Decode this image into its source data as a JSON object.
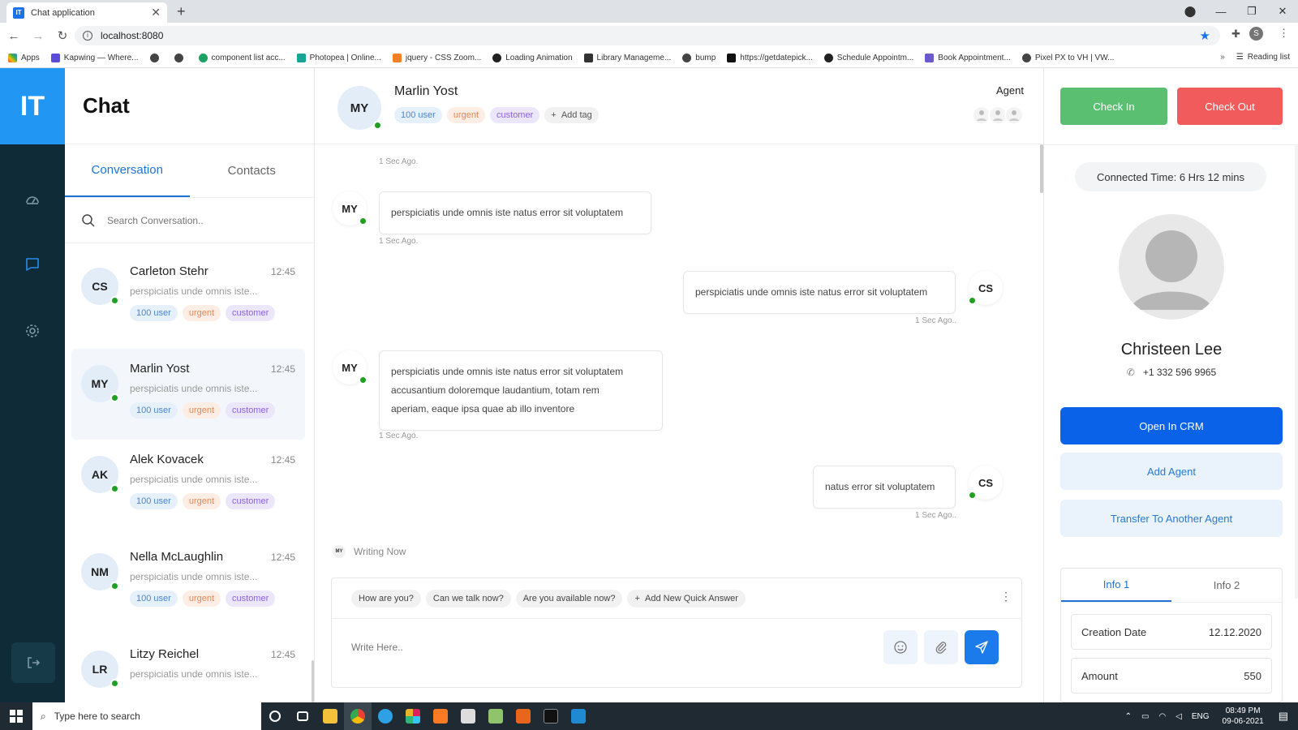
{
  "browser": {
    "tab_title": "Chat application",
    "url": "localhost:8080",
    "bookmarks": [
      "Apps",
      "Kapwing — Where...",
      "component list acc...",
      "Photopea | Online...",
      "jquery - CSS Zoom...",
      "Loading Animation",
      "Library Manageme...",
      "bump",
      "https://getdatepick...",
      "Schedule Appointm...",
      "Book Appointment...",
      "Pixel PX to VH | VW..."
    ],
    "reading_list": "Reading list",
    "profile_initial": "S"
  },
  "app": {
    "logo": "IT",
    "title": "Chat"
  },
  "list": {
    "tabs": [
      "Conversation",
      "Contacts"
    ],
    "search_placeholder": "Search Conversation..",
    "conversations": [
      {
        "initials": "CS",
        "name": "Carleton Stehr",
        "time": "12:45",
        "preview": "perspiciatis unde omnis iste...",
        "tags": [
          "100 user",
          "urgent",
          "customer"
        ]
      },
      {
        "initials": "MY",
        "name": "Marlin Yost",
        "time": "12:45",
        "preview": "perspiciatis unde omnis iste...",
        "tags": [
          "100 user",
          "urgent",
          "customer"
        ]
      },
      {
        "initials": "AK",
        "name": "Alek Kovacek",
        "time": "12:45",
        "preview": "perspiciatis unde omnis iste...",
        "tags": [
          "100 user",
          "urgent",
          "customer"
        ]
      },
      {
        "initials": "NM",
        "name": "Nella McLaughlin",
        "time": "12:45",
        "preview": "perspiciatis unde omnis iste...",
        "tags": [
          "100 user",
          "urgent",
          "customer"
        ]
      },
      {
        "initials": "LR",
        "name": "Litzy Reichel",
        "time": "12:45",
        "preview": "perspiciatis unde omnis iste...",
        "tags": []
      }
    ]
  },
  "chat": {
    "initials": "MY",
    "name": "Marlin Yost",
    "tags": [
      "100 user",
      "urgent",
      "customer"
    ],
    "add_tag": "Add tag",
    "agent_label": "Agent",
    "messages": [
      {
        "stamp": "1 Sec Ago."
      },
      {
        "from": "MY",
        "text": "perspiciatis unde omnis iste natus error sit voluptatem",
        "stamp": "1 Sec Ago."
      },
      {
        "from": "CS",
        "text": "perspiciatis unde omnis iste natus error sit voluptatem",
        "stamp": "1 Sec Ago.."
      },
      {
        "from": "MY",
        "lines": [
          "perspiciatis unde omnis iste natus error sit voluptatem",
          "accusantium doloremque laudantium, totam rem",
          "aperiam, eaque ipsa quae ab illo inventore"
        ],
        "stamp": "1 Sec Ago."
      },
      {
        "from": "CS",
        "text": "natus error sit voluptatem",
        "stamp": "1 Sec Ago.."
      }
    ],
    "writing_initials": "MY",
    "writing_text": "Writing Now",
    "quick_answers": [
      "How are you?",
      "Can we talk now?",
      "Are you available now?"
    ],
    "add_quick_answer": "Add New Quick Answer",
    "input_placeholder": "Write Here.."
  },
  "side": {
    "check_in": "Check In",
    "check_out": "Check Out",
    "connected_time": "Connected Time: 6 Hrs 12 mins",
    "name": "Christeen Lee",
    "phone": "+1 332 596 9965",
    "open_crm": "Open In CRM",
    "add_agent": "Add Agent",
    "transfer": "Transfer To Another Agent",
    "info_tabs": [
      "Info 1",
      "Info 2"
    ],
    "rows": [
      {
        "label": "Creation Date",
        "value": "12.12.2020"
      },
      {
        "label": "Amount",
        "value": "550"
      }
    ]
  },
  "taskbar": {
    "search_placeholder": "Type here to search",
    "lang": "ENG",
    "time": "08:49 PM",
    "date": "09-06-2021"
  },
  "colors": {
    "accent": "#1e74d6",
    "rail": "#0f2b37",
    "check_in": "#5bbf72",
    "check_out": "#f25b5b",
    "online": "#20a020"
  }
}
